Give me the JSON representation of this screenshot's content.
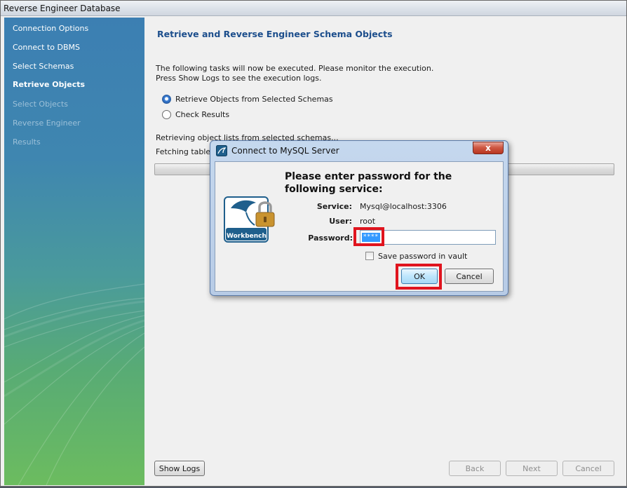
{
  "window": {
    "title": "Reverse Engineer Database"
  },
  "sidebar": {
    "items": [
      {
        "label": "Connection Options",
        "state": "done"
      },
      {
        "label": "Connect to DBMS",
        "state": "done"
      },
      {
        "label": "Select Schemas",
        "state": "done"
      },
      {
        "label": "Retrieve Objects",
        "state": "active"
      },
      {
        "label": "Select Objects",
        "state": "disabled"
      },
      {
        "label": "Reverse Engineer",
        "state": "disabled"
      },
      {
        "label": "Results",
        "state": "disabled"
      }
    ]
  },
  "main": {
    "title": "Retrieve and Reverse Engineer Schema Objects",
    "intro_line1": "The following tasks will now be executed. Please monitor the execution.",
    "intro_line2": "Press Show Logs to see the execution logs.",
    "tasks": [
      {
        "label": "Retrieve Objects from Selected Schemas",
        "state": "current"
      },
      {
        "label": "Check Results",
        "state": "pending"
      }
    ],
    "status_line1": "Retrieving object lists from selected schemas...",
    "status_line2": "Fetching table li"
  },
  "footer": {
    "show_logs": "Show Logs",
    "back": "Back",
    "next": "Next",
    "cancel": "Cancel"
  },
  "dialog": {
    "title": "Connect to MySQL Server",
    "close": "x",
    "heading": "Please enter password for the following service:",
    "service_label": "Service:",
    "service_value": "Mysql@localhost:3306",
    "user_label": "User:",
    "user_value": "root",
    "password_label": "Password:",
    "password_value": "****",
    "save_password_label": "Save password in vault",
    "save_password_checked": false,
    "ok": "OK",
    "cancel": "Cancel",
    "logo_line1": "MySQL",
    "logo_line2": "Workbench"
  },
  "colors": {
    "accent_title": "#1c4e8c",
    "highlight": "#e0141e",
    "selection": "#3399ff"
  }
}
